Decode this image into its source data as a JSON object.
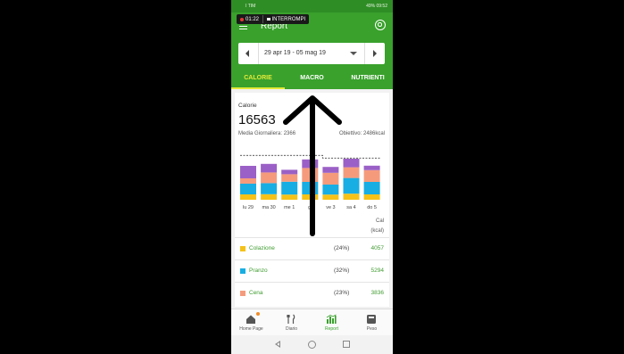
{
  "status_bar": {
    "carrier": "I TIM",
    "battery": "49%",
    "time": "09:52"
  },
  "recording": {
    "time": "01:22",
    "stop_label": "INTERROMPI"
  },
  "app_bar": {
    "title": "Report"
  },
  "date_range": {
    "label": "29 apr 19 - 05 mag 19"
  },
  "tabs": [
    {
      "label": "CALORIE",
      "active": true
    },
    {
      "label": "MACRO",
      "active": false
    },
    {
      "label": "NUTRIENTI",
      "active": false
    }
  ],
  "summary": {
    "label": "Calorie",
    "total": "16563",
    "daily_avg": "Media Giornaliera: 2366",
    "goal": "Obiettivo: 2486kcal"
  },
  "chart_data": {
    "type": "bar",
    "stacked": true,
    "categories": [
      "lu 29",
      "ma 30",
      "me 1",
      "gi",
      "ve 3",
      "sa 4",
      "do 5"
    ],
    "series": [
      {
        "name": "Colazione",
        "color": "#f5c218",
        "values": [
          300,
          310,
          290,
          300,
          290,
          340,
          300
        ]
      },
      {
        "name": "Pranzo",
        "color": "#17aee3",
        "values": [
          600,
          620,
          720,
          700,
          560,
          880,
          700
        ]
      },
      {
        "name": "Cena",
        "color": "#f59b7c",
        "values": [
          300,
          600,
          420,
          780,
          660,
          600,
          660
        ]
      },
      {
        "name": "",
        "color": "#9b60c7",
        "values": [
          700,
          480,
          250,
          480,
          330,
          480,
          250
        ]
      }
    ],
    "goal_line": 2486,
    "ylim": [
      0,
      3000
    ],
    "grid": false
  },
  "table": {
    "header": [
      "Cal",
      "(kcal)"
    ],
    "rows": [
      {
        "name": "Colazione",
        "color": "#f5c218",
        "percent": "(24%)",
        "value": "4057"
      },
      {
        "name": "Pranzo",
        "color": "#17aee3",
        "percent": "(32%)",
        "value": "5294"
      },
      {
        "name": "Cena",
        "color": "#f59b7c",
        "percent": "(23%)",
        "value": "3836"
      }
    ]
  },
  "bottom_nav": [
    {
      "label": "Home Page",
      "icon": "home-icon",
      "active": false
    },
    {
      "label": "Diario",
      "icon": "fork-knife-icon",
      "active": false
    },
    {
      "label": "Report",
      "icon": "report-chart-icon",
      "active": true
    },
    {
      "label": "Peso",
      "icon": "scale-icon",
      "active": false
    }
  ]
}
